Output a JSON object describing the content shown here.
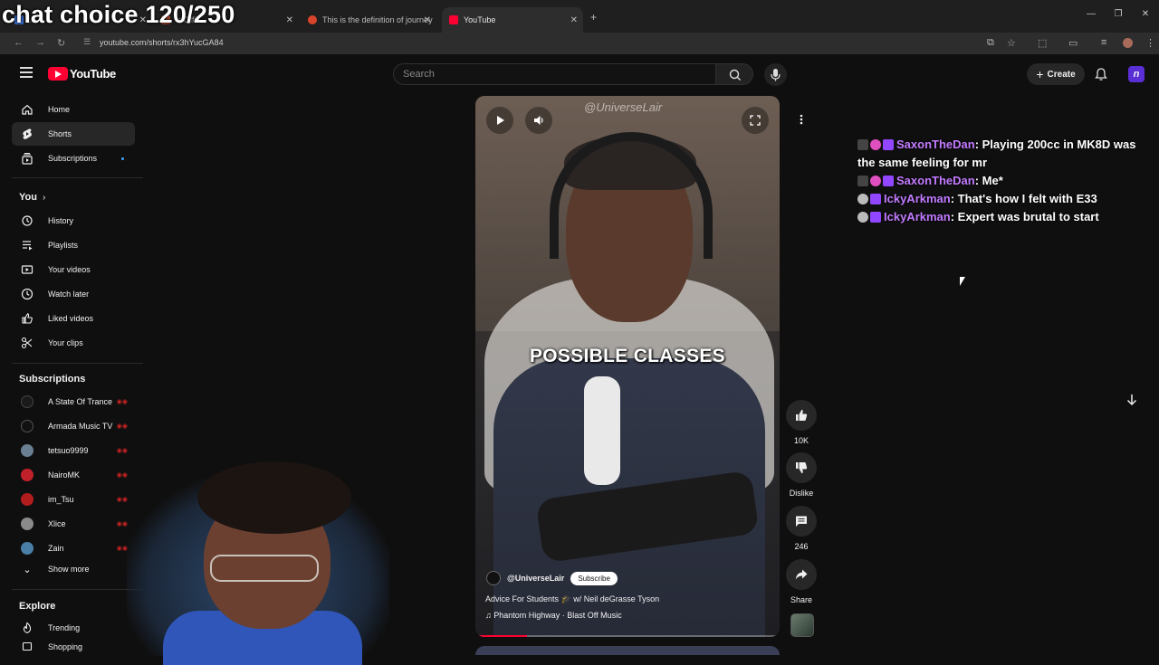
{
  "stream_overlay": {
    "chat_choice": "chat choice 120/250"
  },
  "browser": {
    "tabs": [
      {
        "label": "...",
        "active": false
      },
      {
        "label": "'s Offi",
        "active": false
      },
      {
        "label": "This is the definition of journey",
        "active": false
      },
      {
        "label": "YouTube",
        "active": true
      }
    ],
    "url": "youtube.com/shorts/rx3hYucGA84"
  },
  "header": {
    "logo": "YouTube",
    "search_placeholder": "Search",
    "create_label": "Create"
  },
  "sidebar": {
    "main_items": [
      {
        "label": "Home",
        "icon": "home-icon"
      },
      {
        "label": "Shorts",
        "icon": "shorts-icon",
        "active": true
      },
      {
        "label": "Subscriptions",
        "icon": "subscriptions-icon",
        "new": true
      }
    ],
    "you_heading": "You",
    "you_items": [
      {
        "label": "History",
        "icon": "history-icon"
      },
      {
        "label": "Playlists",
        "icon": "playlists-icon"
      },
      {
        "label": "Your videos",
        "icon": "your-videos-icon"
      },
      {
        "label": "Watch later",
        "icon": "watch-later-icon"
      },
      {
        "label": "Liked videos",
        "icon": "liked-videos-icon"
      },
      {
        "label": "Your clips",
        "icon": "clips-icon"
      }
    ],
    "subscriptions_heading": "Subscriptions",
    "subscriptions": [
      {
        "label": "A State Of Trance",
        "color": "#1a1a1a"
      },
      {
        "label": "Armada Music TV",
        "color": "#111111"
      },
      {
        "label": "tetsuo9999",
        "color": "#6b7f93"
      },
      {
        "label": "NairoMK",
        "color": "#c0202a"
      },
      {
        "label": "im_Tsu",
        "color": "#b11d1d"
      },
      {
        "label": "Xlice",
        "color": "#8a8a8a"
      },
      {
        "label": "Zain",
        "color": "#4a7fa8"
      }
    ],
    "show_more": "Show more",
    "explore_heading": "Explore",
    "explore_items": [
      {
        "label": "Trending",
        "icon": "trending-icon"
      },
      {
        "label": "Shopping",
        "icon": "shopping-icon"
      }
    ]
  },
  "video": {
    "watermark": "@UniverseLair",
    "caption": "POSSIBLE CLASSES",
    "channel": "@UniverseLair",
    "subscribe_label": "Subscribe",
    "title": "Advice For Students 🎓 w/ Neil deGrasse Tyson",
    "music": "Phantom Highway · Blast Off Music",
    "progress_fraction": 0.17
  },
  "actions": {
    "likes": "10K",
    "dislike_label": "Dislike",
    "comments": "246",
    "share_label": "Share"
  },
  "chat": [
    {
      "user": "SaxonTheDan",
      "message": ": Playing 200cc in MK8D was the same feeling for mr"
    },
    {
      "user": "SaxonTheDan",
      "message": ": Me*"
    },
    {
      "user": "IckyArkman",
      "message": ": That's how I felt with E33"
    },
    {
      "user": "IckyArkman",
      "message": ": Expert was brutal to start"
    }
  ],
  "colors": {
    "accent": "#ff0033",
    "chat_username": "#c27bff",
    "background": "#0f0f0f"
  }
}
